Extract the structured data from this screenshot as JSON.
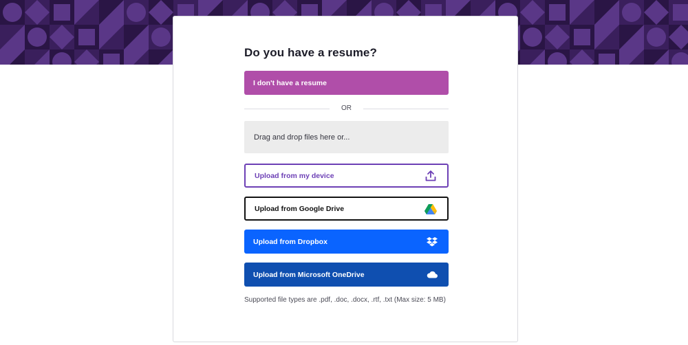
{
  "colors": {
    "banner_bg": "#3a1f5c",
    "banner_accent": "#5a3787",
    "no_resume_button": "#b04ea9",
    "device_button_border": "#6c3fb5",
    "dropbox_button": "#0a64ff",
    "onedrive_button": "#0f4fb0"
  },
  "page": {
    "title": "Do you have a resume?",
    "no_resume_label": "I don't have a resume",
    "divider_text": "OR",
    "dropzone_text": "Drag and drop files here or...",
    "upload_buttons": [
      {
        "label": "Upload from my device",
        "icon": "upload-icon"
      },
      {
        "label": "Upload from Google Drive",
        "icon": "google-drive-icon"
      },
      {
        "label": "Upload from Dropbox",
        "icon": "dropbox-icon"
      },
      {
        "label": "Upload from Microsoft OneDrive",
        "icon": "onedrive-cloud-icon"
      }
    ],
    "supported_types_note": "Supported file types are .pdf, .doc, .docx, .rtf, .txt (Max size: 5 MB)"
  }
}
